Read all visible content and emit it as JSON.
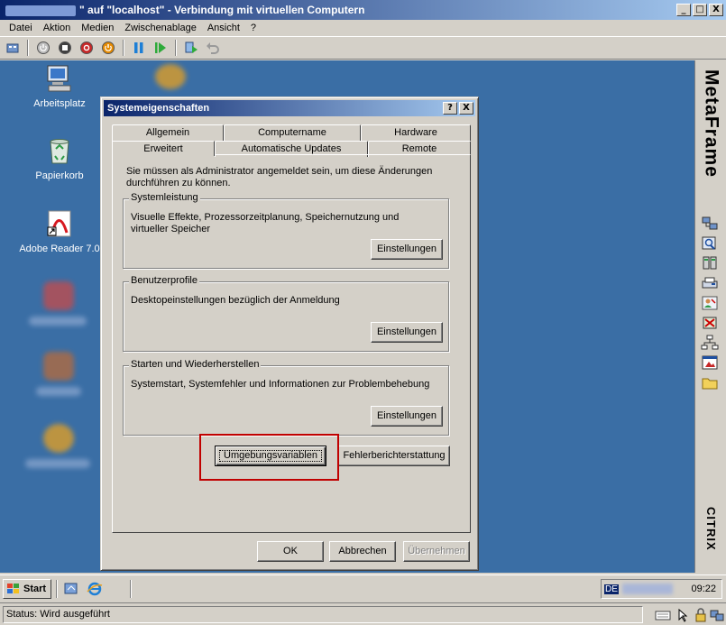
{
  "host_window": {
    "title": "\" auf \"localhost\" - Verbindung mit virtuellen Computern",
    "controls": [
      "_",
      "□",
      "X"
    ]
  },
  "menubar": {
    "items": [
      "Datei",
      "Aktion",
      "Medien",
      "Zwischenablage",
      "Ansicht",
      "?"
    ]
  },
  "toolbar": {
    "icons": [
      "ctrl-alt-del-icon",
      "power-icon",
      "stop-icon",
      "shutdown-icon",
      "reset-icon",
      "pause-icon",
      "resume-icon",
      "snapshot-icon",
      "revert-icon"
    ]
  },
  "desktop": {
    "icons": [
      {
        "label": "Arbeitsplatz",
        "icon": "my-computer-icon"
      },
      {
        "label": "Papierkorb",
        "icon": "recycle-bin-icon"
      },
      {
        "label": "Adobe Reader 7.0",
        "icon": "adobe-reader-icon"
      }
    ]
  },
  "metaframe": {
    "title": "MetaFrame",
    "brand": "CITRIX"
  },
  "dialog": {
    "title": "Systemeigenschaften",
    "help_btn": "?",
    "close_btn": "X",
    "tabs_back": [
      "Allgemein",
      "Computername",
      "Hardware"
    ],
    "tabs_front": [
      "Erweitert",
      "Automatische Updates",
      "Remote"
    ],
    "active_tab": "Erweitert",
    "note": "Sie müssen als Administrator angemeldet sein, um diese Änderungen durchführen zu können.",
    "groups": [
      {
        "legend": "Systemleistung",
        "desc": "Visuelle Effekte, Prozessorzeitplanung, Speichernutzung und virtueller Speicher",
        "button": "Einstellungen"
      },
      {
        "legend": "Benutzerprofile",
        "desc": "Desktopeinstellungen bezüglich der Anmeldung",
        "button": "Einstellungen"
      },
      {
        "legend": "Starten und Wiederherstellen",
        "desc": "Systemstart, Systemfehler und Informationen zur Problembehebung",
        "button": "Einstellungen"
      }
    ],
    "env_button": "Umgebungsvariablen",
    "error_button": "Fehlerberichterstattung",
    "ok": "OK",
    "cancel": "Abbrechen",
    "apply": "Übernehmen",
    "highlight_color": "#c00000"
  },
  "taskbar": {
    "start": "Start",
    "lang": "DE",
    "clock": "09:22"
  },
  "statusbar": {
    "text": "Status: Wird ausgeführt"
  }
}
